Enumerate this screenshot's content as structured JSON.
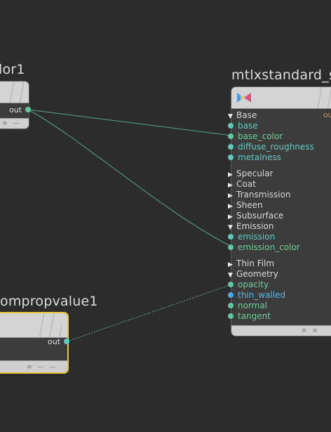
{
  "colors": {
    "background": "#2c2c2c",
    "param_teal": "#64c8c0",
    "param_blue": "#5ab4e8",
    "port_green": "#5fc8a0",
    "port_blue": "#4aa8e8",
    "wire": "#5fb89a",
    "selected_border": "#e8c840"
  },
  "left_node_top": {
    "title": "lor1",
    "out_label": "out",
    "footer_icons": [
      "≡",
      "—"
    ]
  },
  "left_node_bottom": {
    "title": "ompropvalue1",
    "out_label": "out",
    "footer_icons": [
      "≡",
      "—",
      "—"
    ]
  },
  "material_node": {
    "title": "mtlxstandard_s",
    "icon": "materialx-logo-icon",
    "out_label": "ou",
    "sections": [
      {
        "label": "Base",
        "expanded": true,
        "params": [
          {
            "label": "base",
            "color": "teal"
          },
          {
            "label": "base_color",
            "color": "green"
          },
          {
            "label": "diffuse_roughness",
            "color": "teal"
          },
          {
            "label": "metalness",
            "color": "teal"
          }
        ]
      },
      {
        "label": "Specular",
        "expanded": false,
        "params": []
      },
      {
        "label": "Coat",
        "expanded": false,
        "params": []
      },
      {
        "label": "Transmission",
        "expanded": false,
        "params": []
      },
      {
        "label": "Sheen",
        "expanded": false,
        "params": []
      },
      {
        "label": "Subsurface",
        "expanded": false,
        "params": []
      },
      {
        "label": "Emission",
        "expanded": true,
        "params": [
          {
            "label": "emission",
            "color": "teal"
          },
          {
            "label": "emission_color",
            "color": "green"
          }
        ]
      },
      {
        "label": "Thin Film",
        "expanded": false,
        "params": []
      },
      {
        "label": "Geometry",
        "expanded": true,
        "params": [
          {
            "label": "opacity",
            "color": "green"
          },
          {
            "label": "thin_walled",
            "color": "blue"
          },
          {
            "label": "normal",
            "color": "green"
          },
          {
            "label": "tangent",
            "color": "green"
          }
        ]
      }
    ],
    "footer_icons": [
      "≡",
      "≡"
    ]
  }
}
